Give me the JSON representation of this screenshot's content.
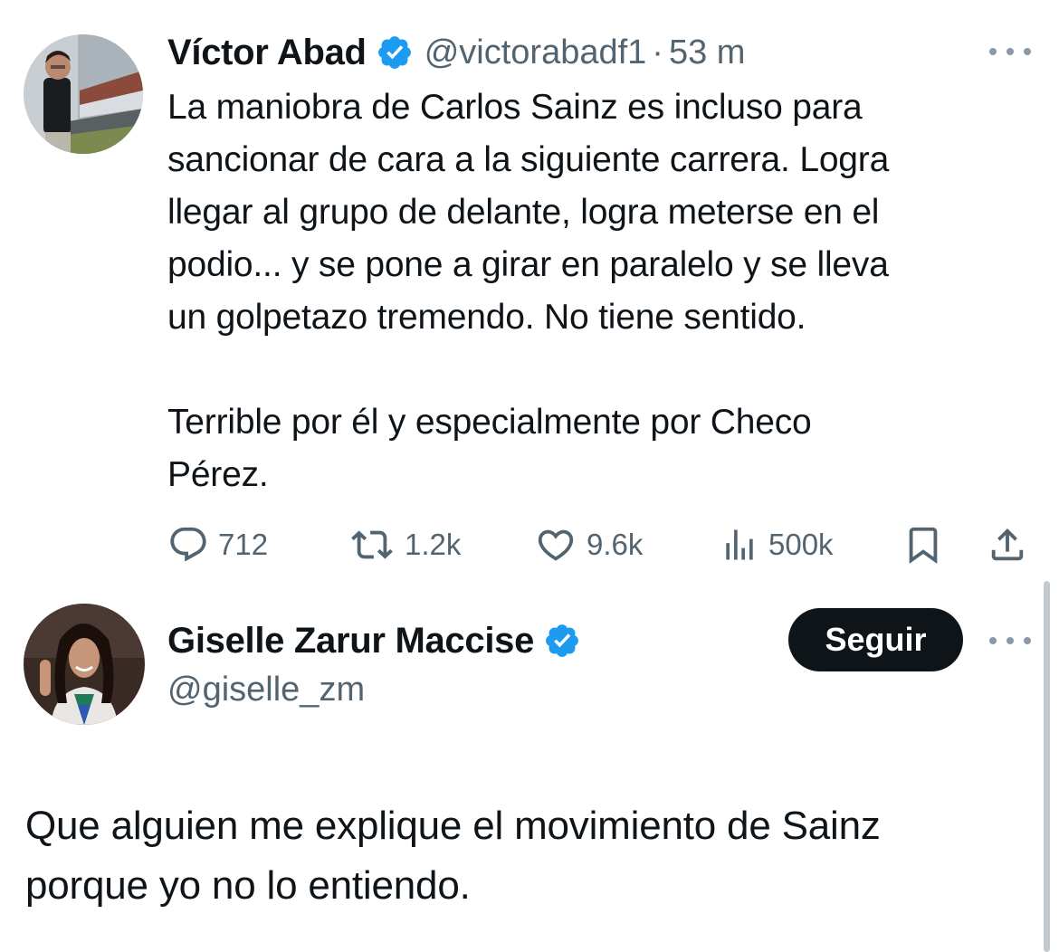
{
  "tweets": [
    {
      "author": {
        "display_name": "Víctor Abad",
        "handle": "@victorabadf1",
        "verified": true
      },
      "separator": "·",
      "time": "53 m",
      "text": "La maniobra de Carlos Sainz es incluso para\nsancionar de cara a la siguiente carrera. Logra\nllegar al grupo de delante, logra meterse en el\npodio... y se pone a girar en paralelo y se lleva\nun golpetazo tremendo. No tiene sentido.\n\nTerrible por él y especialmente por Checo\nPérez.",
      "stats": {
        "replies": "712",
        "reposts": "1.2k",
        "likes": "9.6k",
        "views": "500k"
      }
    },
    {
      "author": {
        "display_name": "Giselle Zarur Maccise",
        "handle": "@giselle_zm",
        "verified": true
      },
      "follow_label": "Seguir",
      "text": "Que alguien me explique el movimiento de Sainz\nporque yo no lo entiendo."
    }
  ],
  "icons": {
    "reply": "speech-bubble-icon",
    "repost": "repost-arrows-icon",
    "like": "heart-icon",
    "views": "bar-chart-icon",
    "bookmark": "bookmark-icon",
    "share": "share-upload-icon",
    "verified": "verified-badge-icon",
    "more": "more-dots-icon"
  },
  "colors": {
    "text_primary": "#0f1419",
    "text_secondary": "#536471",
    "verified_blue": "#1d9bf0",
    "follow_button_bg": "#0f1419",
    "follow_button_text": "#ffffff"
  }
}
